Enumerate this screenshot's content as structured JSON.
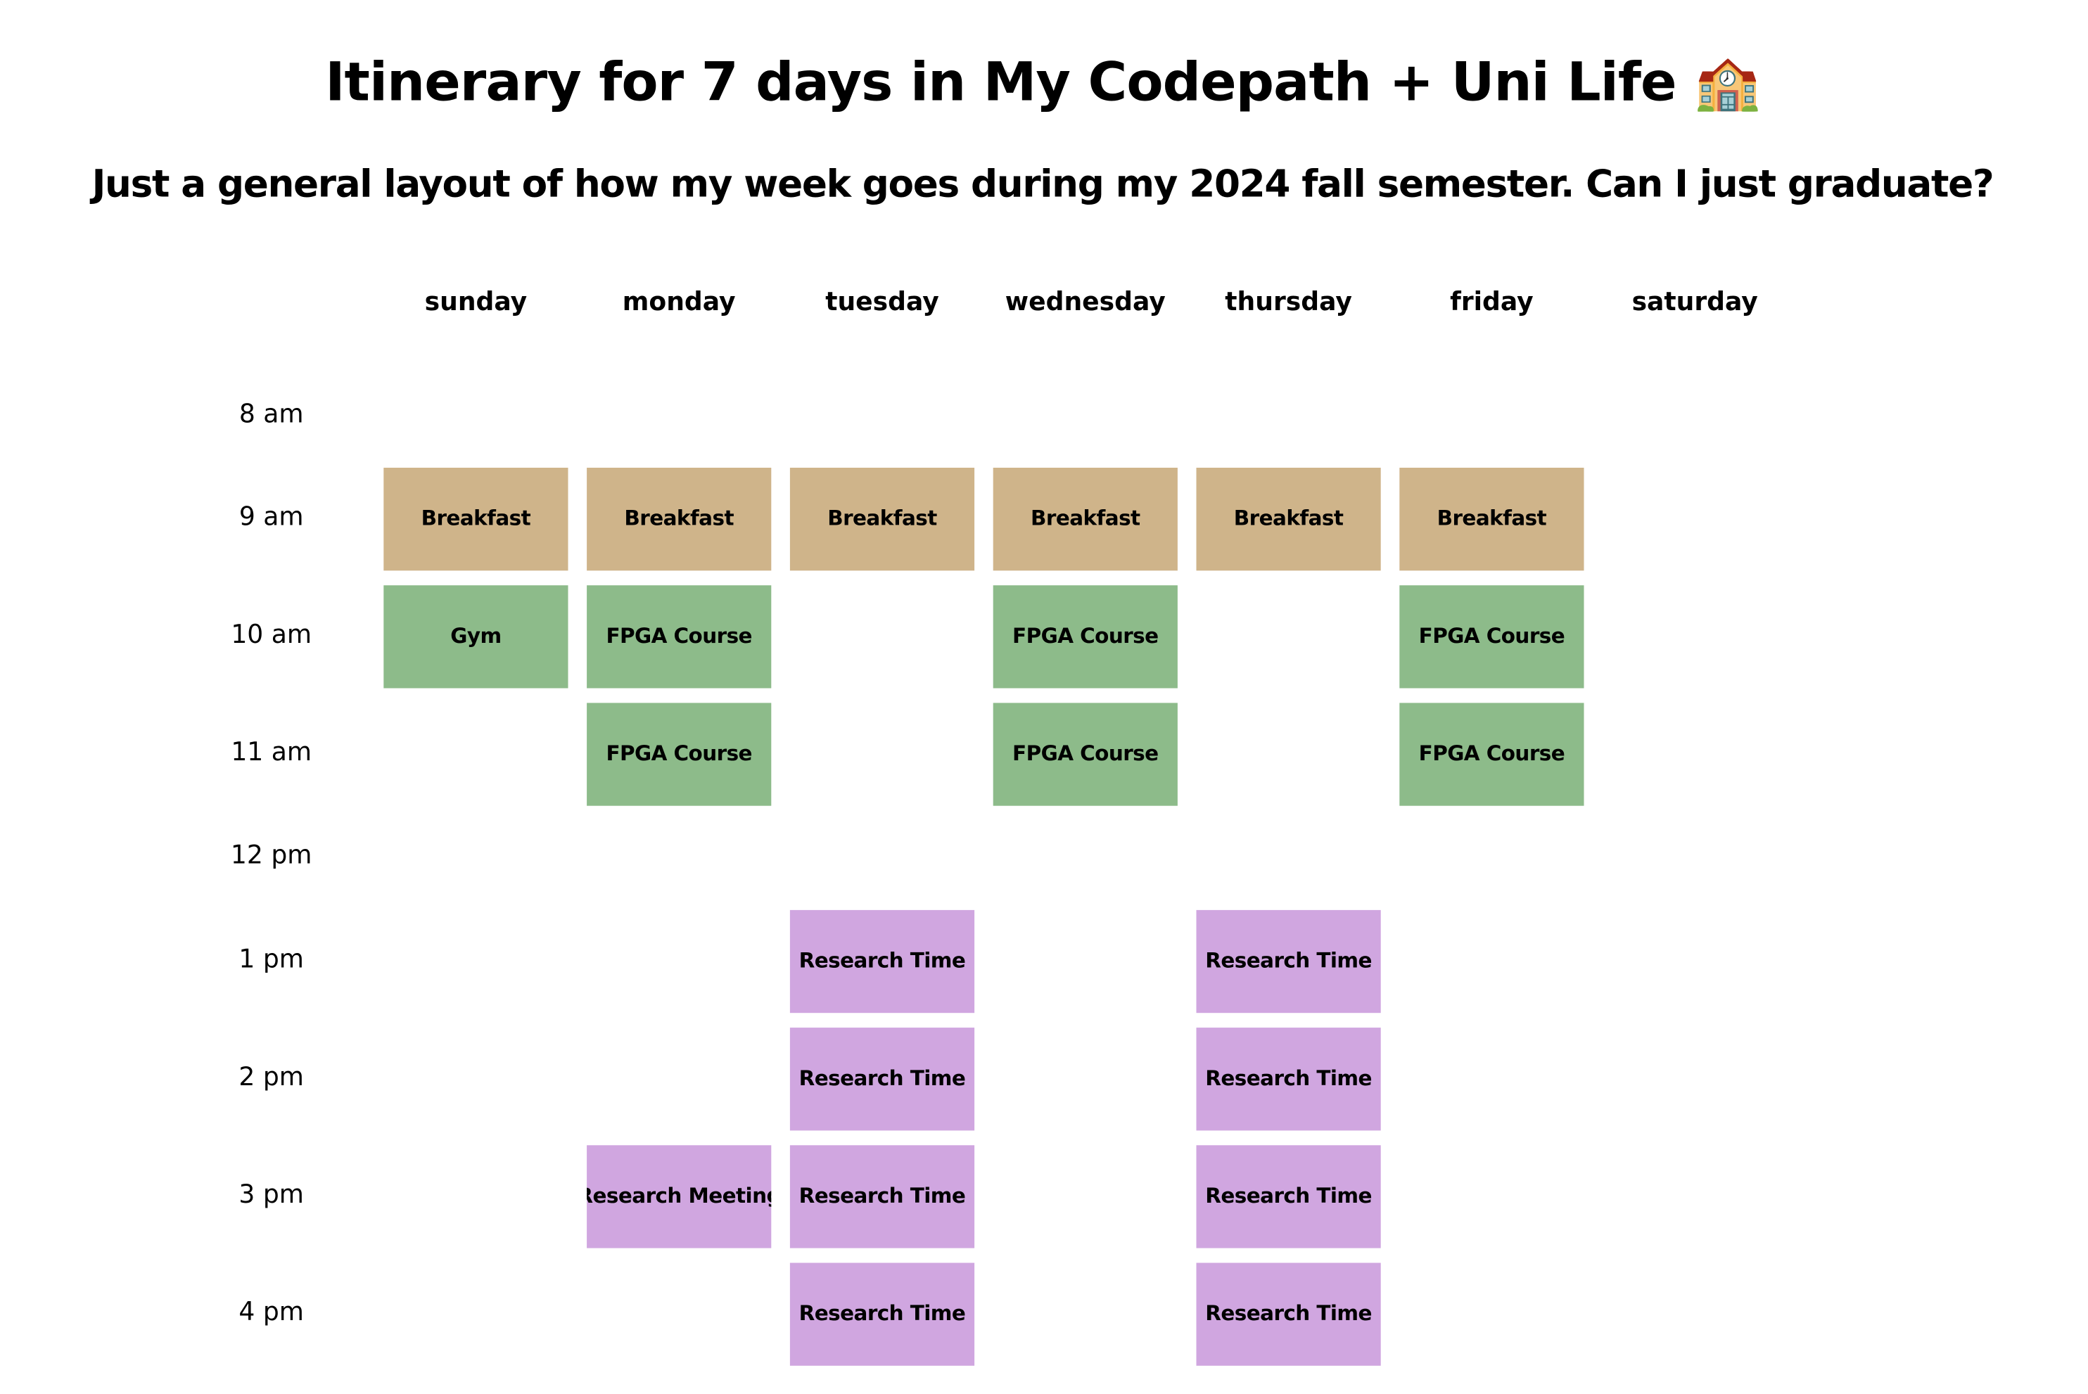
{
  "page": {
    "title": "Itinerary for 7 days in My Codepath + Uni Life 🏫",
    "subtitle": "Just a general layout of how my week goes during my 2024 fall semester. Can I just graduate?"
  },
  "days": [
    "sunday",
    "monday",
    "tuesday",
    "wednesday",
    "thursday",
    "friday",
    "saturday"
  ],
  "times": [
    "8 am",
    "9 am",
    "10 am",
    "11 am",
    "12 pm",
    "1 pm",
    "2 pm",
    "3 pm",
    "4 pm"
  ],
  "colors": {
    "breakfast": "#CFB48A",
    "fpga_course": "#8DBB8A",
    "gym": "#8DBB8A",
    "research": "#D0A6E0"
  },
  "events": [
    {
      "day": "sunday",
      "time": "9 am",
      "label": "Breakfast",
      "category": "breakfast"
    },
    {
      "day": "monday",
      "time": "9 am",
      "label": "Breakfast",
      "category": "breakfast"
    },
    {
      "day": "tuesday",
      "time": "9 am",
      "label": "Breakfast",
      "category": "breakfast"
    },
    {
      "day": "wednesday",
      "time": "9 am",
      "label": "Breakfast",
      "category": "breakfast"
    },
    {
      "day": "thursday",
      "time": "9 am",
      "label": "Breakfast",
      "category": "breakfast"
    },
    {
      "day": "friday",
      "time": "9 am",
      "label": "Breakfast",
      "category": "breakfast"
    },
    {
      "day": "sunday",
      "time": "10 am",
      "label": "Gym",
      "category": "gym"
    },
    {
      "day": "monday",
      "time": "10 am",
      "label": "FPGA Course",
      "category": "fpga_course"
    },
    {
      "day": "wednesday",
      "time": "10 am",
      "label": "FPGA Course",
      "category": "fpga_course"
    },
    {
      "day": "friday",
      "time": "10 am",
      "label": "FPGA Course",
      "category": "fpga_course"
    },
    {
      "day": "monday",
      "time": "11 am",
      "label": "FPGA Course",
      "category": "fpga_course"
    },
    {
      "day": "wednesday",
      "time": "11 am",
      "label": "FPGA Course",
      "category": "fpga_course"
    },
    {
      "day": "friday",
      "time": "11 am",
      "label": "FPGA Course",
      "category": "fpga_course"
    },
    {
      "day": "tuesday",
      "time": "1 pm",
      "label": "Research Time",
      "category": "research"
    },
    {
      "day": "thursday",
      "time": "1 pm",
      "label": "Research Time",
      "category": "research"
    },
    {
      "day": "tuesday",
      "time": "2 pm",
      "label": "Research Time",
      "category": "research"
    },
    {
      "day": "thursday",
      "time": "2 pm",
      "label": "Research Time",
      "category": "research"
    },
    {
      "day": "monday",
      "time": "3 pm",
      "label": "Research Meeting",
      "category": "research"
    },
    {
      "day": "tuesday",
      "time": "3 pm",
      "label": "Research Time",
      "category": "research"
    },
    {
      "day": "thursday",
      "time": "3 pm",
      "label": "Research Time",
      "category": "research"
    },
    {
      "day": "tuesday",
      "time": "4 pm",
      "label": "Research Time",
      "category": "research"
    },
    {
      "day": "thursday",
      "time": "4 pm",
      "label": "Research Time",
      "category": "research"
    }
  ]
}
